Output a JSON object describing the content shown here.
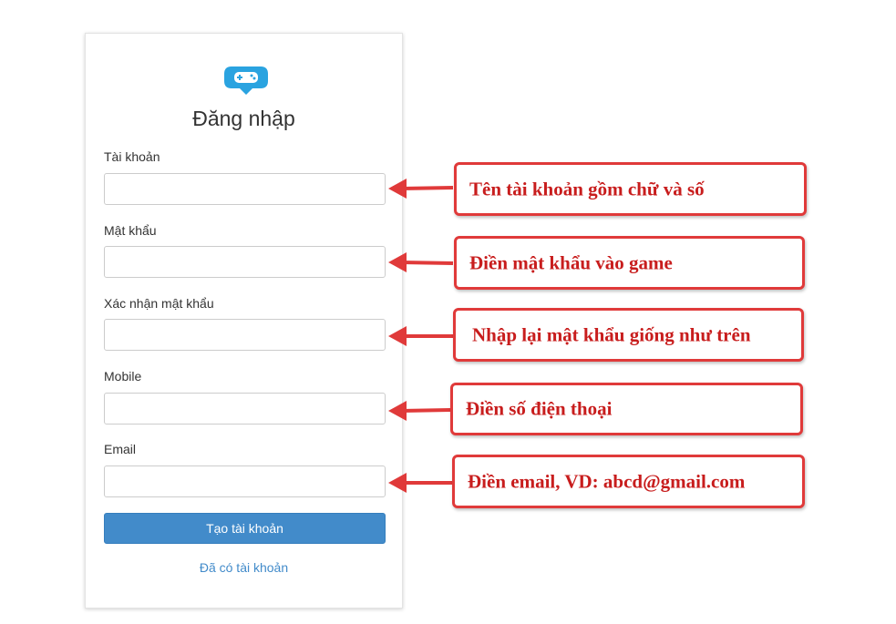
{
  "form": {
    "title": "Đăng nhập",
    "fields": [
      {
        "label": "Tài khoản",
        "value": "",
        "placeholder": ""
      },
      {
        "label": "Mật khẩu",
        "value": "",
        "placeholder": ""
      },
      {
        "label": "Xác nhận mật khẩu",
        "value": "",
        "placeholder": ""
      },
      {
        "label": "Mobile",
        "value": "",
        "placeholder": ""
      },
      {
        "label": "Email",
        "value": "",
        "placeholder": ""
      }
    ],
    "submit_label": "Tạo tài khoản",
    "login_link": "Đã có tài khoản"
  },
  "annotations": [
    "Tên tài khoản gồm chữ và số",
    "Điền mật khẩu vào game",
    "Nhập lại mật khẩu giống như trên",
    "Điền số điện thoại",
    "Điền email, VD: abcd@gmail.com"
  ],
  "colors": {
    "accent": "#428bca",
    "annotation_red": "#e03a3a",
    "annotation_text": "#c81d1d",
    "logo_blue": "#2aa3e0"
  }
}
